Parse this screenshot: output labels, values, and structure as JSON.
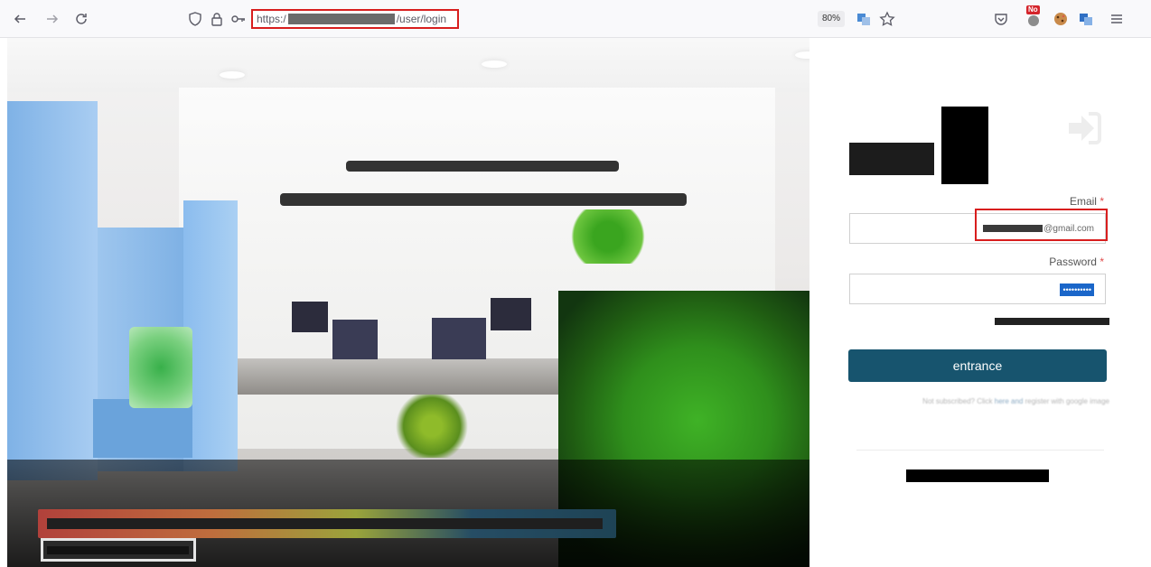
{
  "browser": {
    "url_prefix": "https:/",
    "url_suffix": "/user/login",
    "zoom": "80%",
    "extension_badge": "No"
  },
  "login": {
    "email_label": "Email",
    "email_required": "*",
    "email_value_suffix": "@gmail.com",
    "password_label": "Password",
    "password_required": "*",
    "password_value": "••••••••••",
    "submit_label": "entrance",
    "helper_text_start": "Not subscribed? Click",
    "helper_link": "here and",
    "helper_text_end": "register with google image"
  },
  "colors": {
    "submit_bg": "#17546e",
    "highlight": "#d81e1e",
    "required": "#e04b4b"
  }
}
